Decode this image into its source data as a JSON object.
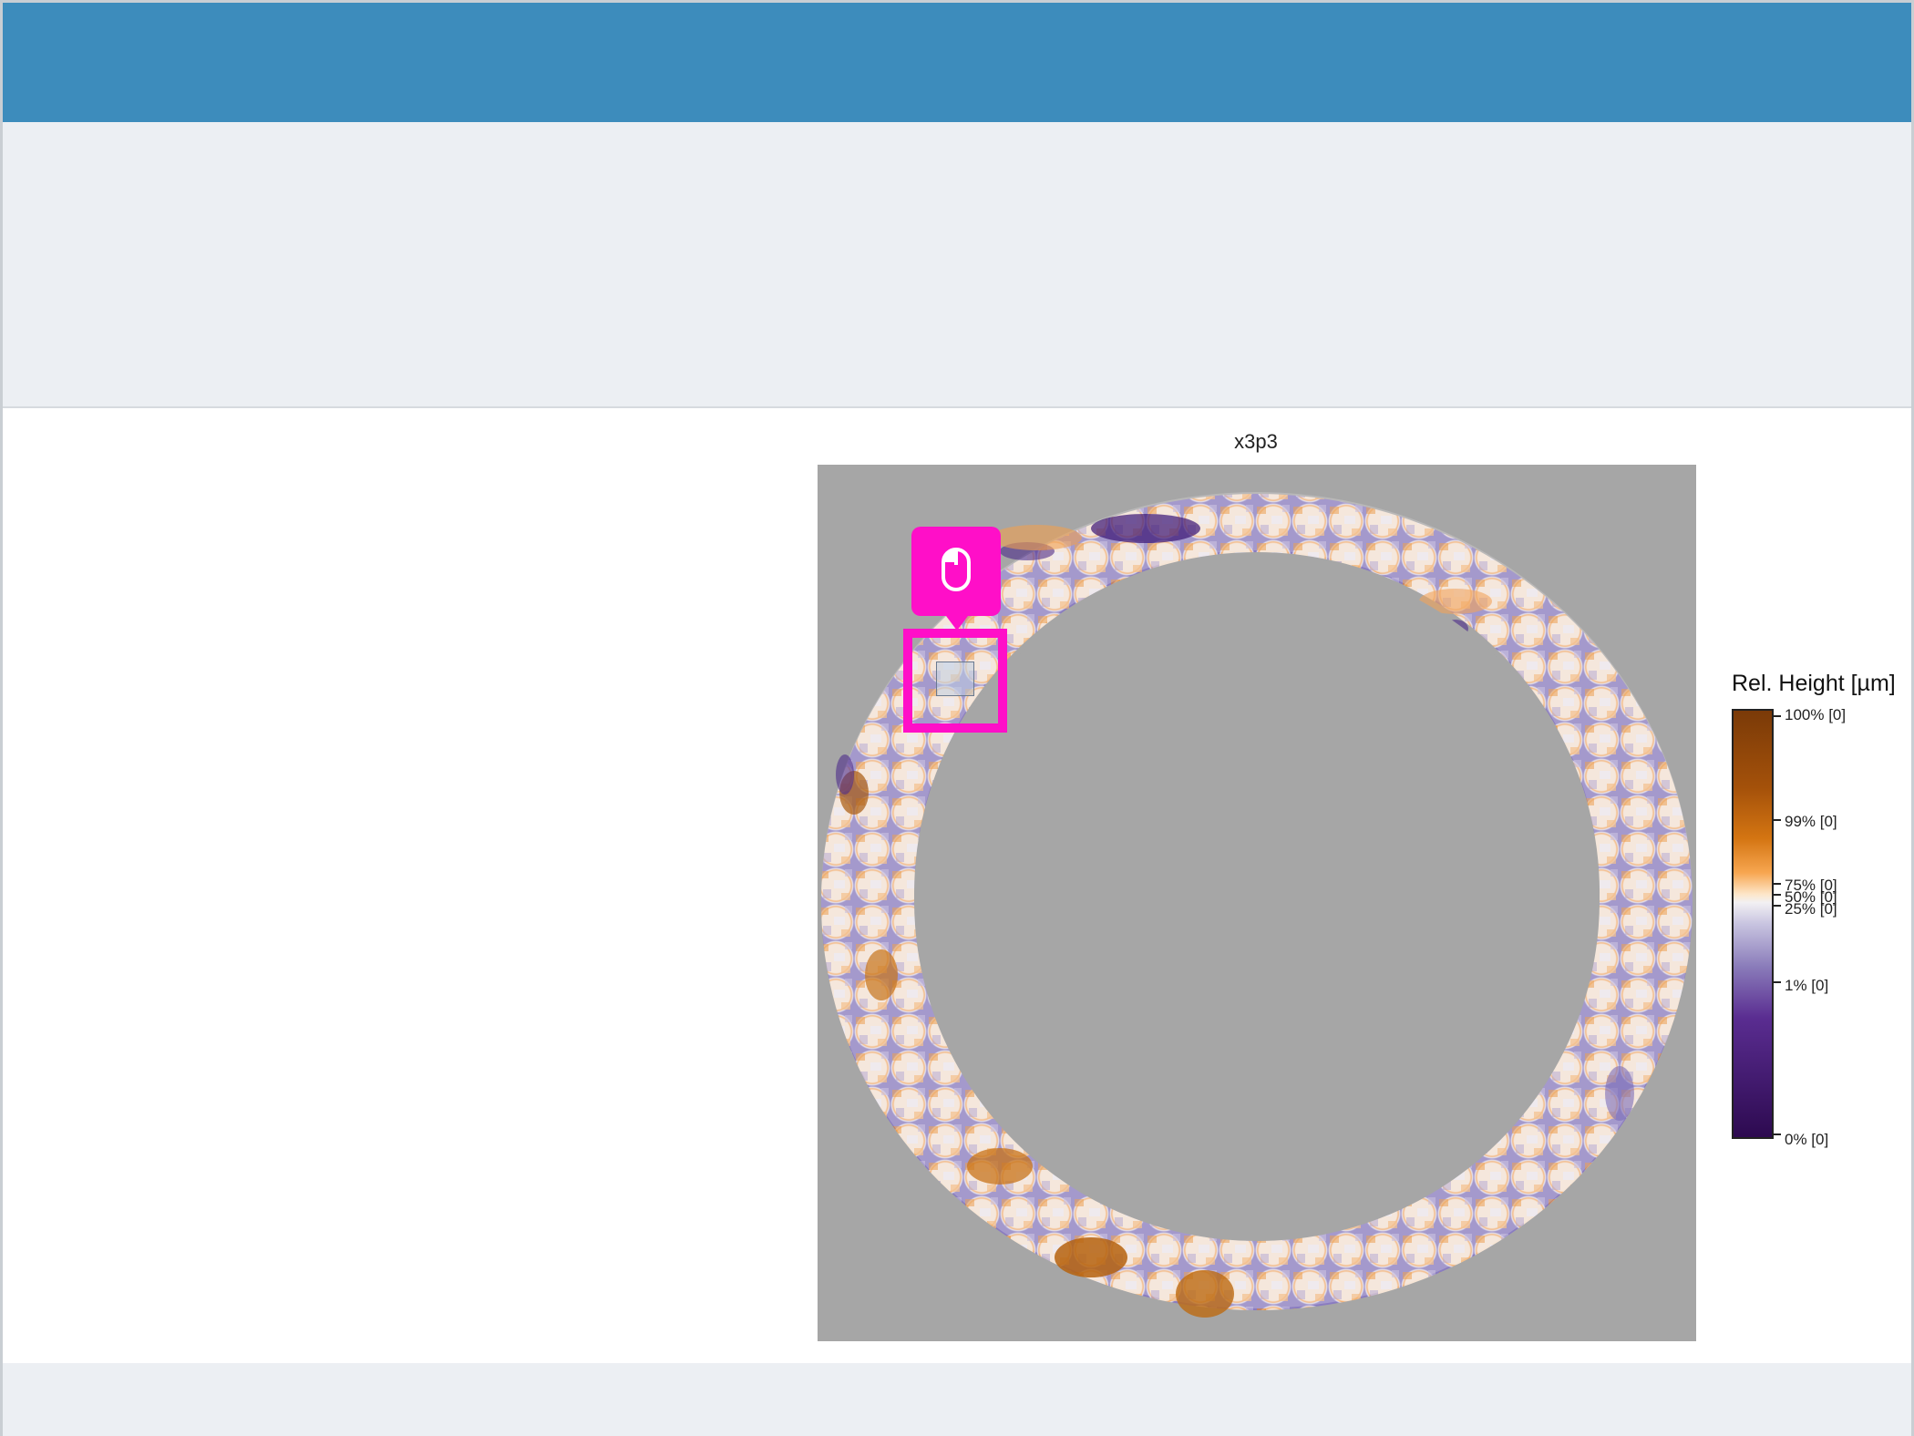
{
  "plot": {
    "title": "x3p3"
  },
  "colorbar": {
    "title": "Rel. Height [µm]",
    "ticks": [
      {
        "label": "100% [0]"
      },
      {
        "label": "99% [0]"
      },
      {
        "label": "75% [0]"
      },
      {
        "label": "50% [0]"
      },
      {
        "label": "25% [0]"
      },
      {
        "label": "1% [0]"
      },
      {
        "label": "0% [0]"
      }
    ]
  },
  "colors": {
    "header": "#3d8cbc",
    "toolbar": "#eceff3",
    "annotation": "#ff0fc8",
    "plot_background": "#a6a6a6"
  },
  "icons": {
    "annotation": "mouse-icon"
  }
}
